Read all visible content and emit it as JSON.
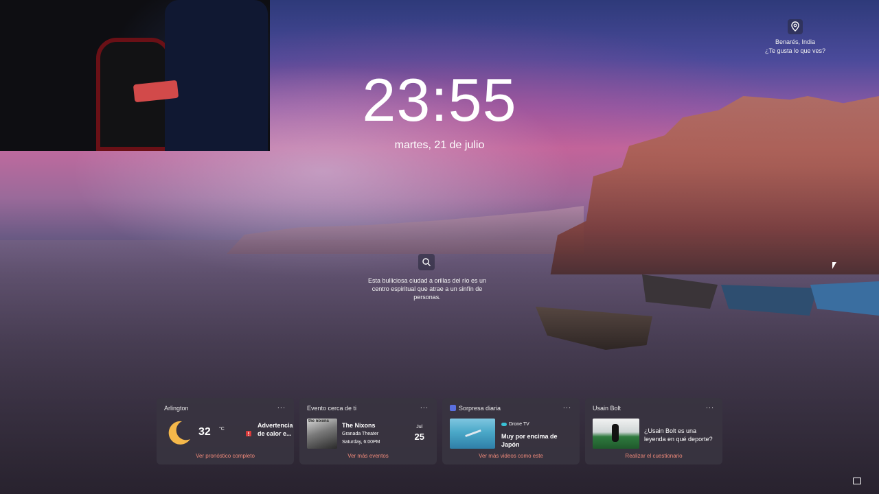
{
  "lockscreen": {
    "time": "23:55",
    "date": "martes, 21 de julio"
  },
  "location": {
    "icon": "location-pin-icon",
    "name": "Benarés, India",
    "like_prompt": "¿Te gusta lo que ves?"
  },
  "spotlight": {
    "search_icon": "search-icon",
    "caption": "Esta bulliciosa ciudad a orillas del río es un centro espiritual que atrae a un sinfín de personas."
  },
  "widgets": {
    "weather": {
      "title": "Arlington",
      "more": "...",
      "icon": "crescent-moon-icon",
      "temperature": "32",
      "unit": "°C",
      "alert_icon": "alert-icon",
      "alert": "Advertencia de calor e...",
      "link": "Ver pronóstico completo"
    },
    "event": {
      "title": "Evento cerca de ti",
      "more": "...",
      "thumb_text": "the nixons",
      "name": "The Nixons",
      "venue": "Granada Theater",
      "time": "Saturday, 6:00PM",
      "month": "Jul",
      "day": "25",
      "link": "Ver más eventos"
    },
    "video": {
      "title": "Sorpresa diaria",
      "more": "...",
      "source": "Drone TV",
      "headline": "Muy por encima de Japón",
      "link": "Ver más videos como este"
    },
    "quiz": {
      "title": "Usain Bolt",
      "more": "...",
      "question": "¿Usain Bolt es una leyenda en qué deporte?",
      "link": "Realizar el cuestionario"
    }
  },
  "colors": {
    "card_bg": "#383440",
    "link_accent": "#f08a7a",
    "moon": "#f5b84a"
  }
}
